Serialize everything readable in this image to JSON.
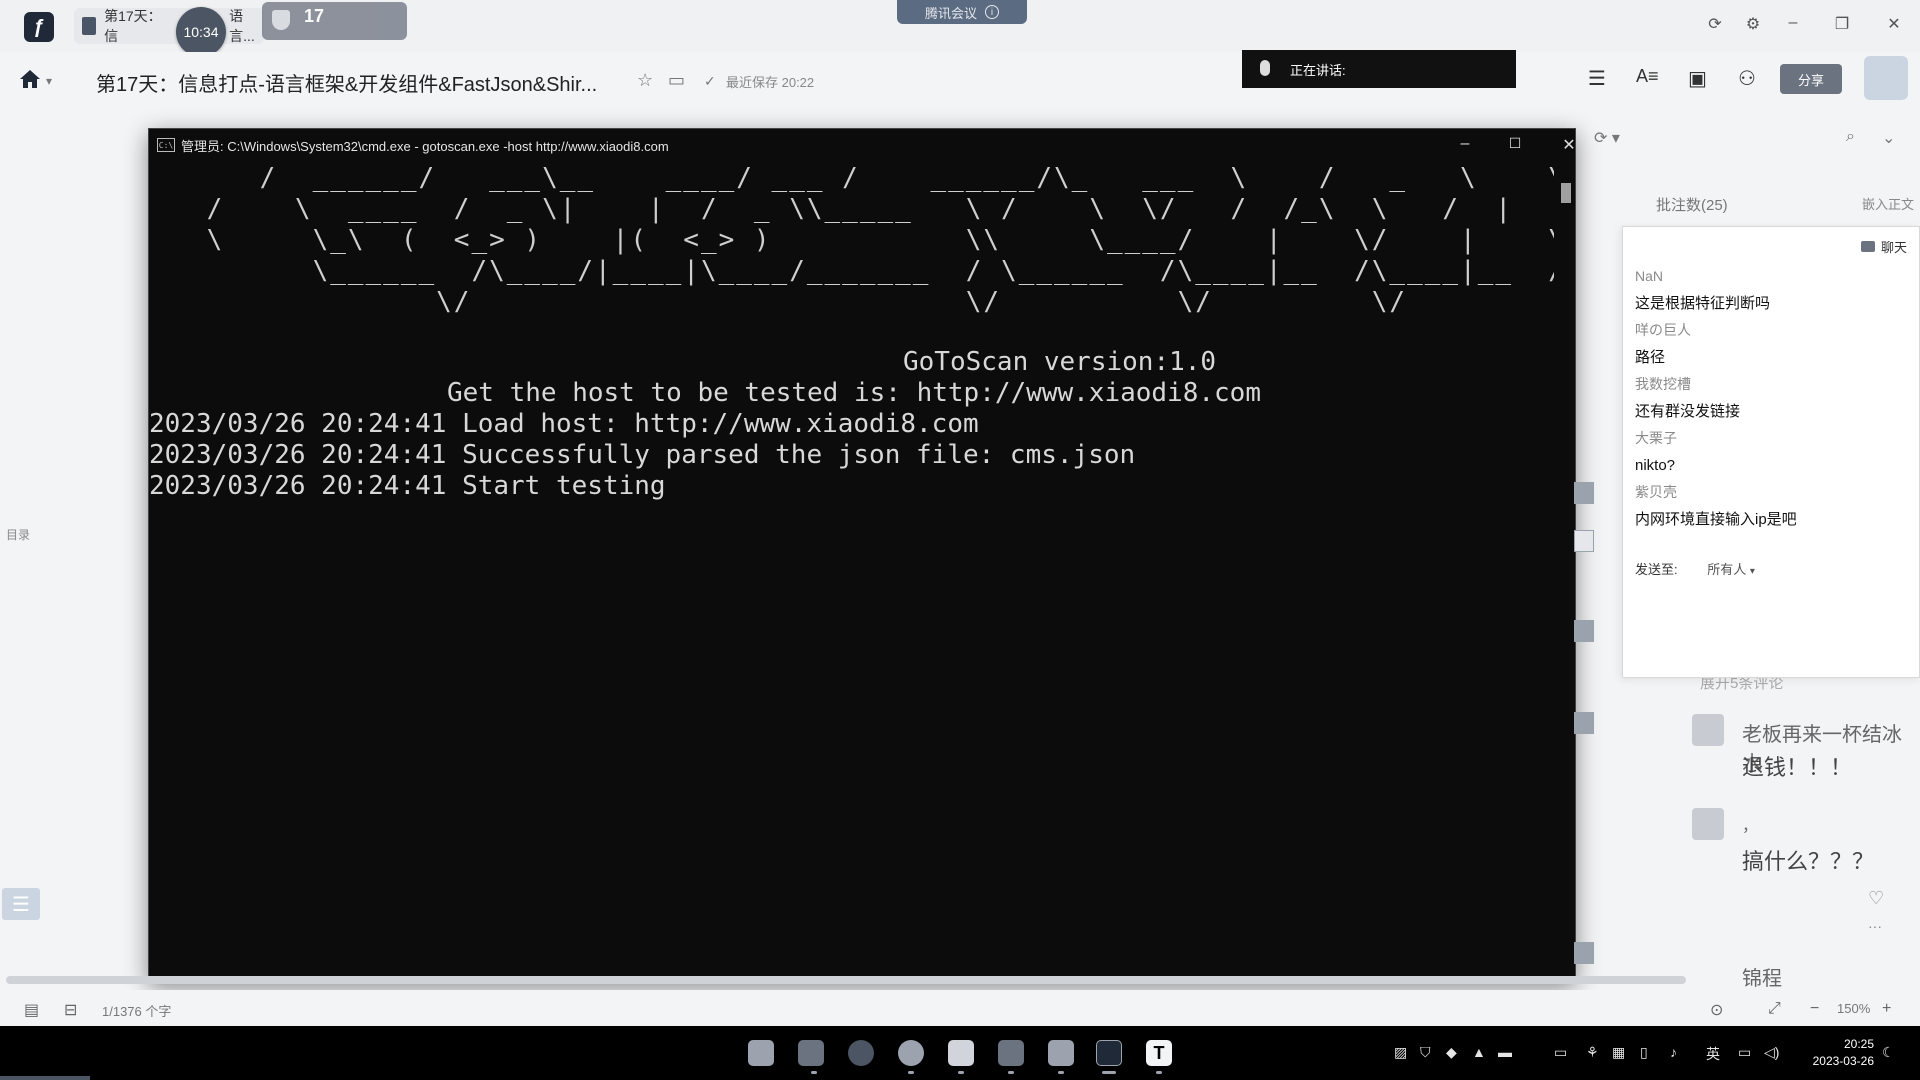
{
  "topbar": {
    "doc_tab_label": "第17天：信",
    "doc_tab_suffix": "语言...",
    "time_badge": "10:34",
    "shield_number": "17",
    "meeting_label": "腾讯会议",
    "meeting_info_icon": "i"
  },
  "doc_toolbar": {
    "title": "第17天：信息打点-语言框架&开发组件&FastJson&Shir...",
    "saved_status": "最近保存 20:22",
    "speaking_label": "正在讲话:",
    "share_label": "分享"
  },
  "left_edge": {
    "toc_label": "目录"
  },
  "cmd": {
    "title": "管理员: C:\\Windows\\System32\\cmd.exe - gotoscan.exe  -host http://www.xiaodi8.com",
    "ascii_art": "    /  ______/   ___\\__    ____/ ___ /    ______/\\_   ___  \\    /   _   \\    \\      \\\n /    \\  ____  /  _ \\|    |  /  _ \\\\_____   \\ /    \\  \\/   /  /_\\  \\   /  |   \\\n \\     \\_\\  (  <_> )    |(  <_> )           \\\\     \\____/    |    \\/    |    \\\n       \\______  /\\____/|____|\\____/_______  / \\______  /\\____|__  /\\____|__  /\n              \\/                            \\/          \\/         \\/         \\/",
    "version_line": "GoToScan version:1.0",
    "host_prompt": "Get the host to be tested is: http://www.xiaodi8.com",
    "log_lines": [
      "2023/03/26 20:24:41 Load host: http://www.xiaodi8.com",
      "2023/03/26 20:24:41 Successfully parsed the json file: cms.json",
      "2023/03/26 20:24:41 Start testing"
    ]
  },
  "right_panel": {
    "annotation_count": "批注数(25)",
    "embed_label": "嵌入正文",
    "chat_title": "聊天",
    "messages": [
      {
        "name": "NaN",
        "text": "这是根据特征判断吗"
      },
      {
        "name": "咩の巨人",
        "text": "路径"
      },
      {
        "name": "我数挖槽",
        "text": "还有群没发链接"
      },
      {
        "name": "大栗子",
        "text": "nikto?"
      },
      {
        "name": "紫贝壳",
        "text": "内网环境直接输入ip是吧"
      }
    ],
    "send_to_label": "发送至:",
    "send_to_value": "所有人",
    "faint_text": "展开5条评论",
    "bg_comments": [
      "老板再来一杯结冰水",
      "退钱！！！",
      "，",
      "搞什么？？？",
      "锦程"
    ]
  },
  "statusbar": {
    "page_count": "1/1376 个字",
    "zoom": "150%"
  },
  "taskbar": {
    "time": "20:25",
    "date": "2023-03-26",
    "ime": "英",
    "terminal_app_letter": "T"
  },
  "colors": {
    "cmd_background": "#0c0c0c",
    "cmd_text": "#d0d0d0",
    "taskbar": "#000000",
    "page_background": "#f3f4f6"
  }
}
